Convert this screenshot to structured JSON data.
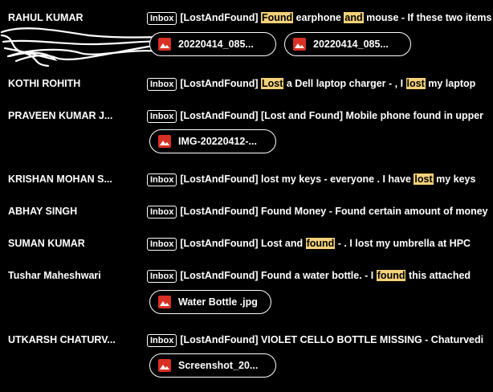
{
  "label": "Inbox",
  "rows": [
    {
      "sender": "RAHUL KUMAR",
      "subject_parts": [
        {
          "t": "[LostAndFound] ",
          "hl": false
        },
        {
          "t": "Found",
          "hl": true
        },
        {
          "t": " earphone ",
          "hl": false
        },
        {
          "t": "and",
          "hl": true
        },
        {
          "t": " mouse - If these two items",
          "hl": false
        }
      ],
      "attachments": [
        "20220414_085...",
        "20220414_085..."
      ]
    },
    {
      "sender": "KOTHI ROHITH",
      "subject_parts": [
        {
          "t": "[LostAndFound] ",
          "hl": false
        },
        {
          "t": "Lost",
          "hl": true
        },
        {
          "t": " a Dell laptop charger - , I ",
          "hl": false
        },
        {
          "t": "lost",
          "hl": true
        },
        {
          "t": " my laptop",
          "hl": false
        }
      ],
      "attachments": []
    },
    {
      "sender": "PRAVEEN KUMAR J...",
      "subject_parts": [
        {
          "t": "[LostAndFound] [Lost and Found] Mobile phone found in upper",
          "hl": false
        }
      ],
      "attachments": [
        "IMG-20220412-..."
      ]
    },
    {
      "sender": "KRISHAN MOHAN S...",
      "subject_parts": [
        {
          "t": "[LostAndFound] lost my keys - everyone . I have ",
          "hl": false
        },
        {
          "t": "lost",
          "hl": true
        },
        {
          "t": " my keys",
          "hl": false
        }
      ],
      "attachments": []
    },
    {
      "sender": "ABHAY SINGH",
      "subject_parts": [
        {
          "t": "[LostAndFound] Found Money - Found certain amount of money",
          "hl": false
        }
      ],
      "attachments": []
    },
    {
      "sender": "SUMAN KUMAR",
      "subject_parts": [
        {
          "t": "[LostAndFound] Lost and ",
          "hl": false
        },
        {
          "t": "found",
          "hl": true
        },
        {
          "t": " - . I lost my umbrella at HPC",
          "hl": false
        }
      ],
      "attachments": []
    },
    {
      "sender": "Tushar Maheshwari",
      "subject_parts": [
        {
          "t": "[LostAndFound] Found a water bottle. - I ",
          "hl": false
        },
        {
          "t": "found",
          "hl": true
        },
        {
          "t": " this attached",
          "hl": false
        }
      ],
      "attachments": [
        "Water Bottle .jpg"
      ]
    },
    {
      "sender": "UTKARSH CHATURV...",
      "subject_parts": [
        {
          "t": "[LostAndFound] VIOLET CELLO BOTTLE MISSING - Chaturvedi",
          "hl": false
        }
      ],
      "attachments": [
        "Screenshot_20..."
      ]
    }
  ]
}
